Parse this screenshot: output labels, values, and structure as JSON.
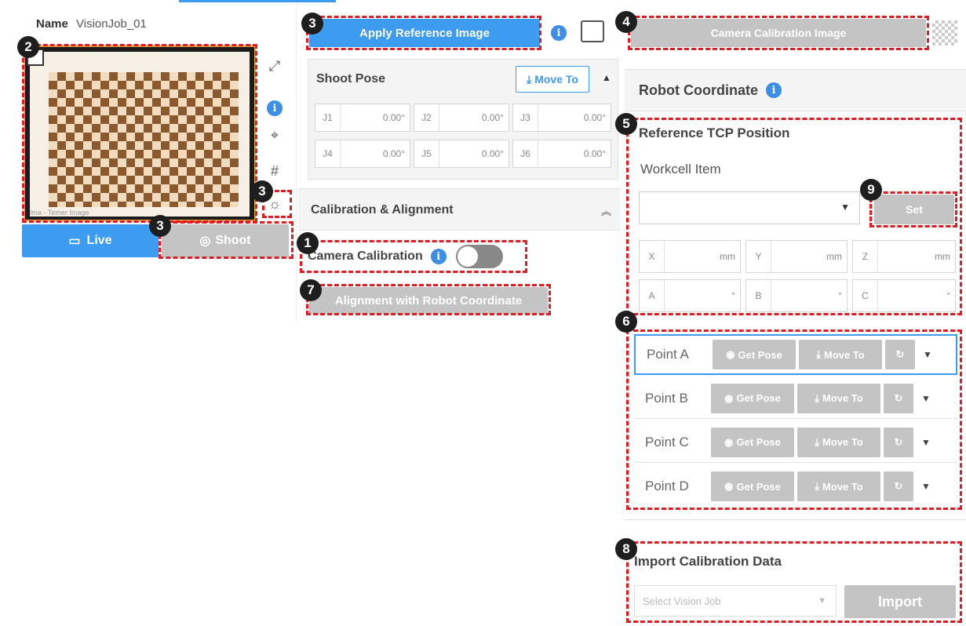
{
  "job": {
    "name_label": "Name",
    "name_value": "VisionJob_01"
  },
  "camera": {
    "live_label": "Live",
    "shoot_label": "Shoot",
    "watermark": "Ima - Temer Image"
  },
  "top": {
    "apply_reference": "Apply Reference Image",
    "camera_calibration_image": "Camera Calibration Image"
  },
  "shoot_pose": {
    "title": "Shoot Pose",
    "move_to": "Move To",
    "joints": [
      {
        "label": "J1",
        "value": "0.00°"
      },
      {
        "label": "J2",
        "value": "0.00°"
      },
      {
        "label": "J3",
        "value": "0.00°"
      },
      {
        "label": "J4",
        "value": "0.00°"
      },
      {
        "label": "J5",
        "value": "0.00°"
      },
      {
        "label": "J6",
        "value": "0.00°"
      }
    ]
  },
  "calib": {
    "section_title": "Calibration & Alignment",
    "camera_calibration": "Camera Calibration",
    "alignment": "Alignment with Robot Coordinate"
  },
  "robot": {
    "title": "Robot Coordinate",
    "ref_tcp": "Reference TCP Position",
    "workcell_item": "Workcell Item",
    "set_label": "Set",
    "coords": [
      {
        "label": "X",
        "unit": "mm"
      },
      {
        "label": "Y",
        "unit": "mm"
      },
      {
        "label": "Z",
        "unit": "mm"
      },
      {
        "label": "A",
        "unit": "°"
      },
      {
        "label": "B",
        "unit": "°"
      },
      {
        "label": "C",
        "unit": "°"
      }
    ]
  },
  "points": {
    "get_pose": "Get Pose",
    "move_to": "Move To",
    "items": [
      {
        "name": "Point A"
      },
      {
        "name": "Point B"
      },
      {
        "name": "Point C"
      },
      {
        "name": "Point D"
      }
    ]
  },
  "import": {
    "title": "Import Calibration Data",
    "placeholder": "Select Vision Job",
    "button": "Import"
  },
  "badges": [
    "1",
    "2",
    "3",
    "3",
    "3",
    "3",
    "4",
    "5",
    "6",
    "7",
    "8",
    "9"
  ],
  "colors": {
    "accent": "#3d9bf0",
    "annotation": "#e01b22",
    "disabled": "#c4c4c4",
    "checker_orange": "#f0a640"
  }
}
